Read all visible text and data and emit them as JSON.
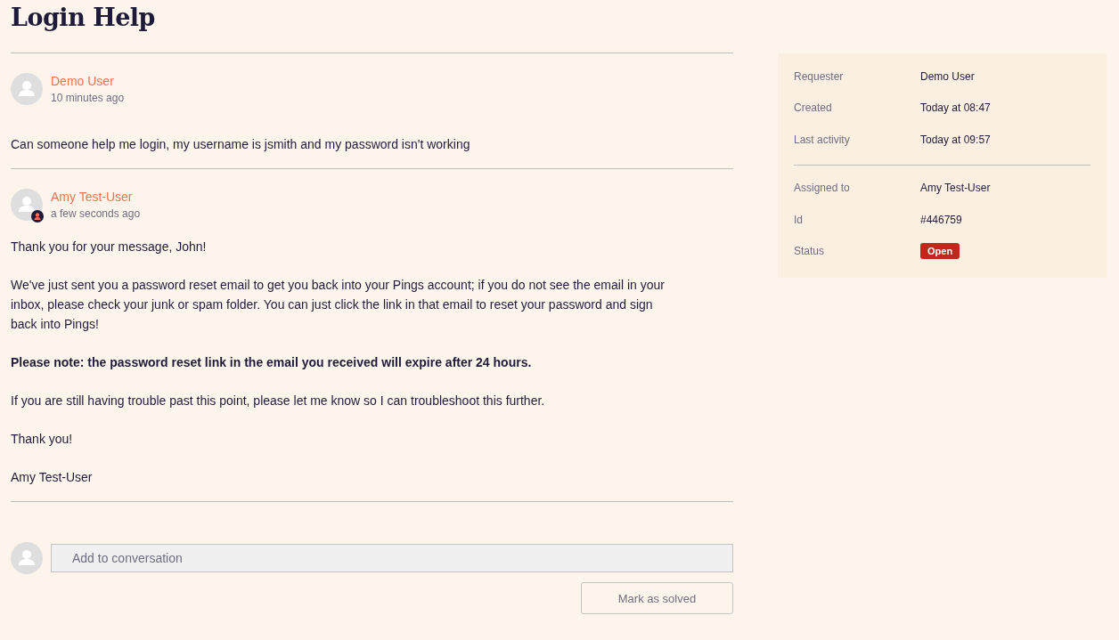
{
  "title": "Login Help",
  "messages": [
    {
      "author": "Demo User",
      "time": "10 minutes ago",
      "agent": false,
      "paragraphs": [
        {
          "text": "Can someone help me login, my username is jsmith and my password isn't working",
          "bold": false
        }
      ]
    },
    {
      "author": "Amy Test-User",
      "time": "a few seconds ago",
      "agent": true,
      "paragraphs": [
        {
          "text": "Thank you for your message, John!",
          "bold": false
        },
        {
          "text": "We've just sent you a password reset email to get you back into your Pings account; if you do not see the email in your inbox, please check your junk or spam folder. You can just click the link in that email to reset your password and sign back into Pings!",
          "bold": false
        },
        {
          "text": "Please note: the password reset link in the email you received will expire after 24 hours.",
          "bold": true
        },
        {
          "text": "If you are still having trouble past this point, please let me know so I can troubleshoot this further.",
          "bold": false
        },
        {
          "text": "Thank you!",
          "bold": false
        },
        {
          "text": "Amy Test-User",
          "bold": false
        }
      ]
    }
  ],
  "reply": {
    "placeholder": "Add to conversation"
  },
  "actions": [
    "Mark as solved"
  ],
  "details": [
    [
      {
        "label": "Requester",
        "value": "Demo User",
        "kind": "text"
      },
      {
        "label": "Created",
        "value": "Today at 08:47",
        "kind": "text"
      },
      {
        "label": "Last activity",
        "value": "Today at 09:57",
        "kind": "text"
      }
    ],
    [
      {
        "label": "Assigned to",
        "value": "Amy Test-User",
        "kind": "text"
      },
      {
        "label": "Id",
        "value": "#446759",
        "kind": "text"
      },
      {
        "label": "Status",
        "value": "Open",
        "kind": "badge",
        "color": "#c0281c"
      }
    ]
  ]
}
